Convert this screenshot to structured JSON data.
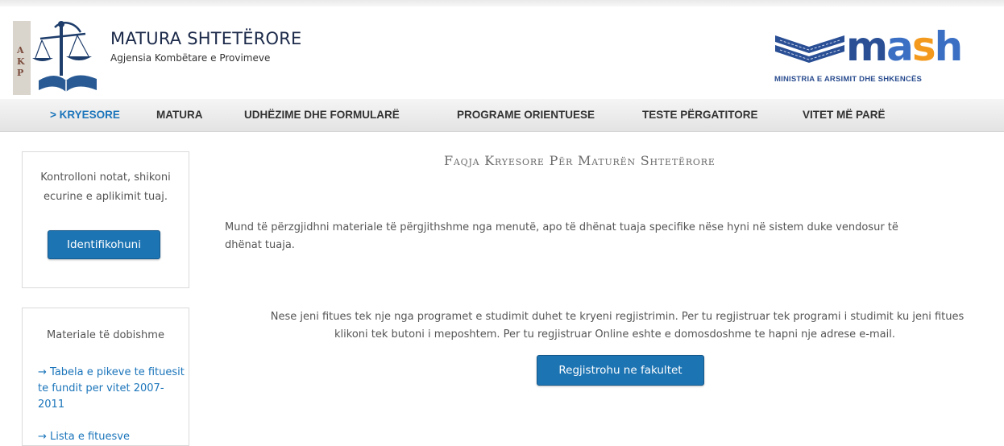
{
  "header": {
    "logo_letters": [
      "A",
      "K",
      "P"
    ],
    "title": "MATURA SHTETËRORE",
    "subtitle": "Agjensia Kombëtare e Provimeve",
    "ministry_logo_text": "mash",
    "ministry_caption": "MINISTRIA E ARSIMIT DHE SHKENCËS"
  },
  "nav": {
    "items": [
      {
        "label": "> KRYESORE"
      },
      {
        "label": "MATURA"
      },
      {
        "label": "UDHËZIME DHE FORMULARË"
      },
      {
        "label": "PROGRAME ORIENTUESE"
      },
      {
        "label": "TESTE PËRGATITORE"
      },
      {
        "label": "VITET MË PARË"
      }
    ]
  },
  "sidebar": {
    "login_text": "Kontrolloni notat, shikoni ecurine e aplikimit tuaj.",
    "login_button": "Identifikohuni",
    "materials_title": "Materiale të dobishme",
    "materials_link": "→ Tabela e pikeve te fituesit te fundit per vitet 2007-2011",
    "materials_next": "→ Lista e fituesve"
  },
  "main": {
    "title": "Faqja Kryesore Për Maturën Shtetërore",
    "intro_line1": "Mund të përzgjidhni materiale të përgjithshme nga menutë, apo të dhënat tuaja specifike nëse hyni në sistem duke vendosur të",
    "intro_line2": "dhënat tuaja.",
    "register_line1": "Nese jeni fitues tek nje nga programet e studimit duhet te kryeni regjistrimin. Per tu regjistruar tek programi i studimit ku jeni fitues",
    "register_line2": "klikoni tek butoni i meposhtem. Per tu regjistruar Online eshte e domosdoshme te hapni nje adrese e-mail.",
    "register_button": "Regjistrohu ne fakultet"
  },
  "colors": {
    "accent": "#1b75bb",
    "button": "#1d74b3",
    "title_navy": "#1c2a4a"
  }
}
